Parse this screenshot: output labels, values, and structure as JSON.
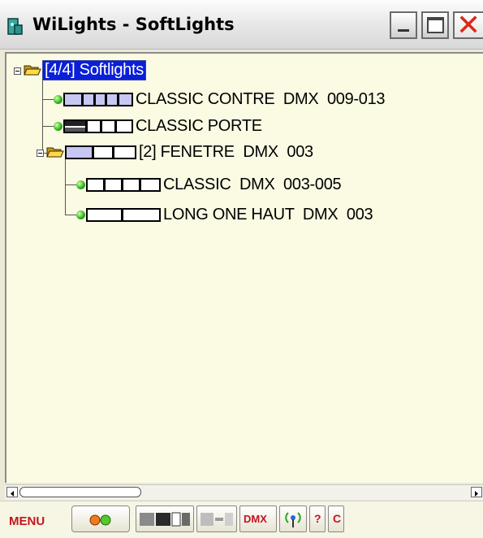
{
  "window": {
    "title": "WiLights - SoftLights"
  },
  "tree": {
    "root_label": "[4/4] Softlights",
    "items": [
      {
        "label": "CLASSIC CONTRE  DMX  009-013"
      },
      {
        "label": "CLASSIC PORTE"
      },
      {
        "label": "[2] FENETRE  DMX  003"
      },
      {
        "label": "CLASSIC  DMX  003-005"
      },
      {
        "label": "LONG ONE HAUT  DMX  003"
      }
    ]
  },
  "toolbar": {
    "menu_label": "MENU",
    "dmx_label": "DMX",
    "help_label": "?",
    "c_label": "C"
  },
  "colors": {
    "led_green": "#35b51f",
    "selection_blue": "#0a1fd8",
    "menu_red": "#c0161d",
    "tree_bg": "#fbfbe3"
  }
}
